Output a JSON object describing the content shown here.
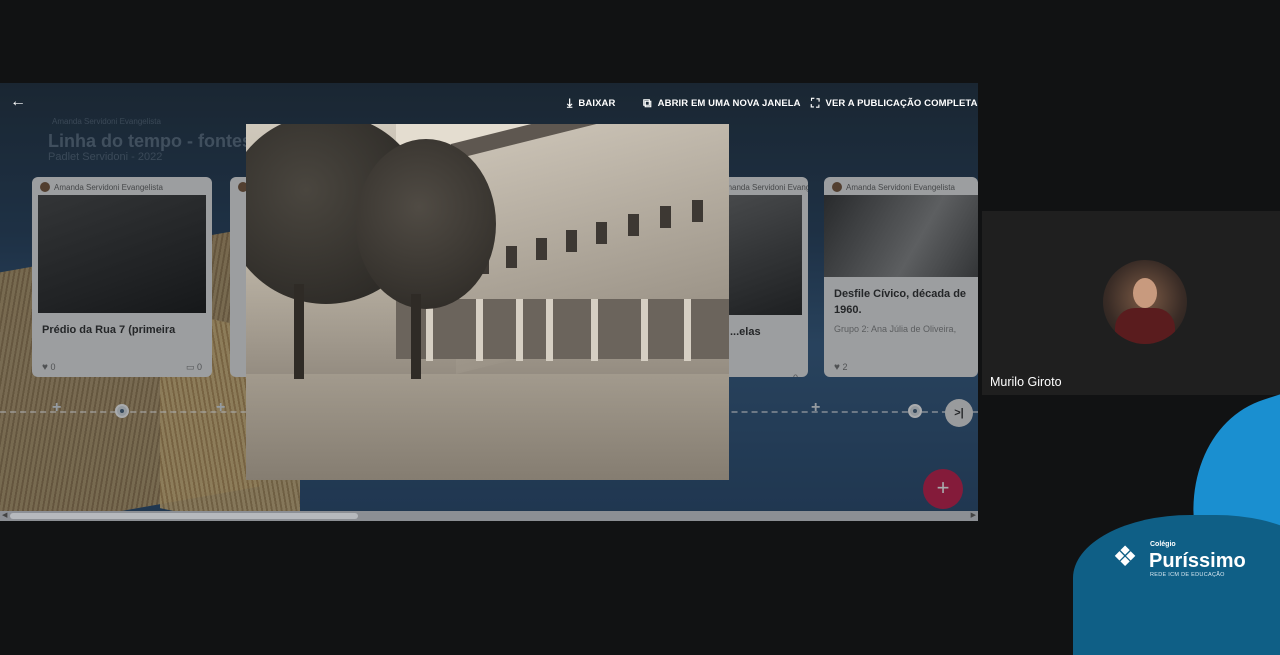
{
  "board": {
    "author_top": "Amanda Servidoni Evangelista",
    "title": "Linha do tempo - fontes h",
    "subtitle": "Padlet Servidoni - 2022"
  },
  "cards": [
    {
      "author": "Amanda Servidoni Evangelista",
      "title": "Prédio da Rua 7 (primeira",
      "group": "",
      "likes": "0",
      "comments": "0"
    },
    {
      "author": "Amanda Servidoni Evangelista",
      "title": "...elas",
      "group": "",
      "likes": "",
      "comments": "0"
    },
    {
      "author": "Amanda Servidoni Evangelista",
      "title": "Desfile Cívico, década de 1960.",
      "group": "Grupo 2: Ana Júlia de Oliveira,",
      "likes": "2",
      "comments": ""
    }
  ],
  "toolbar": {
    "back_icon": "arrow-left-icon",
    "download_label": "BAIXAR",
    "open_new_window_label": "ABRIR EM UMA NOVA JANELA",
    "full_publication_label": "VER A PUBLICAÇÃO COMPLETA"
  },
  "timeline": {
    "next_label": ">|"
  },
  "fab": {
    "label": "+"
  },
  "participant": {
    "name": "Murilo Giroto"
  },
  "brand": {
    "small": "Colégio",
    "name": "Puríssimo",
    "tagline": "REDE ICM DE EDUCAÇÃO"
  },
  "colors": {
    "accent": "#c7234f",
    "brand_blue": "#1a8fd0",
    "brand_dark": "#0f5f86"
  }
}
